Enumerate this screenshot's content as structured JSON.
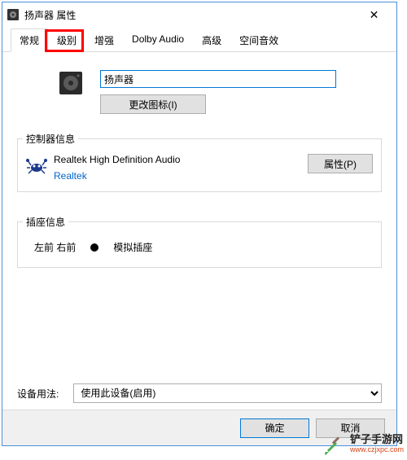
{
  "window": {
    "title": "扬声器 属性"
  },
  "tabs": {
    "items": [
      {
        "label": "常规"
      },
      {
        "label": "级别"
      },
      {
        "label": "增强"
      },
      {
        "label": "Dolby Audio"
      },
      {
        "label": "高级"
      },
      {
        "label": "空间音效"
      }
    ],
    "active_index": 0,
    "highlighted_index": 1
  },
  "general": {
    "device_name": "扬声器",
    "change_icon_label": "更改图标(I)"
  },
  "controller": {
    "group_label": "控制器信息",
    "name": "Realtek High Definition Audio",
    "vendor": "Realtek",
    "properties_label": "属性(P)"
  },
  "jack": {
    "group_label": "插座信息",
    "position": "左前 右前",
    "type": "模拟插座"
  },
  "usage": {
    "label": "设备用法:",
    "selected": "使用此设备(启用)"
  },
  "buttons": {
    "ok": "确定",
    "cancel": "取消"
  },
  "watermark": {
    "zh": "铲子手游网",
    "en": "www.czjxpc.com"
  }
}
